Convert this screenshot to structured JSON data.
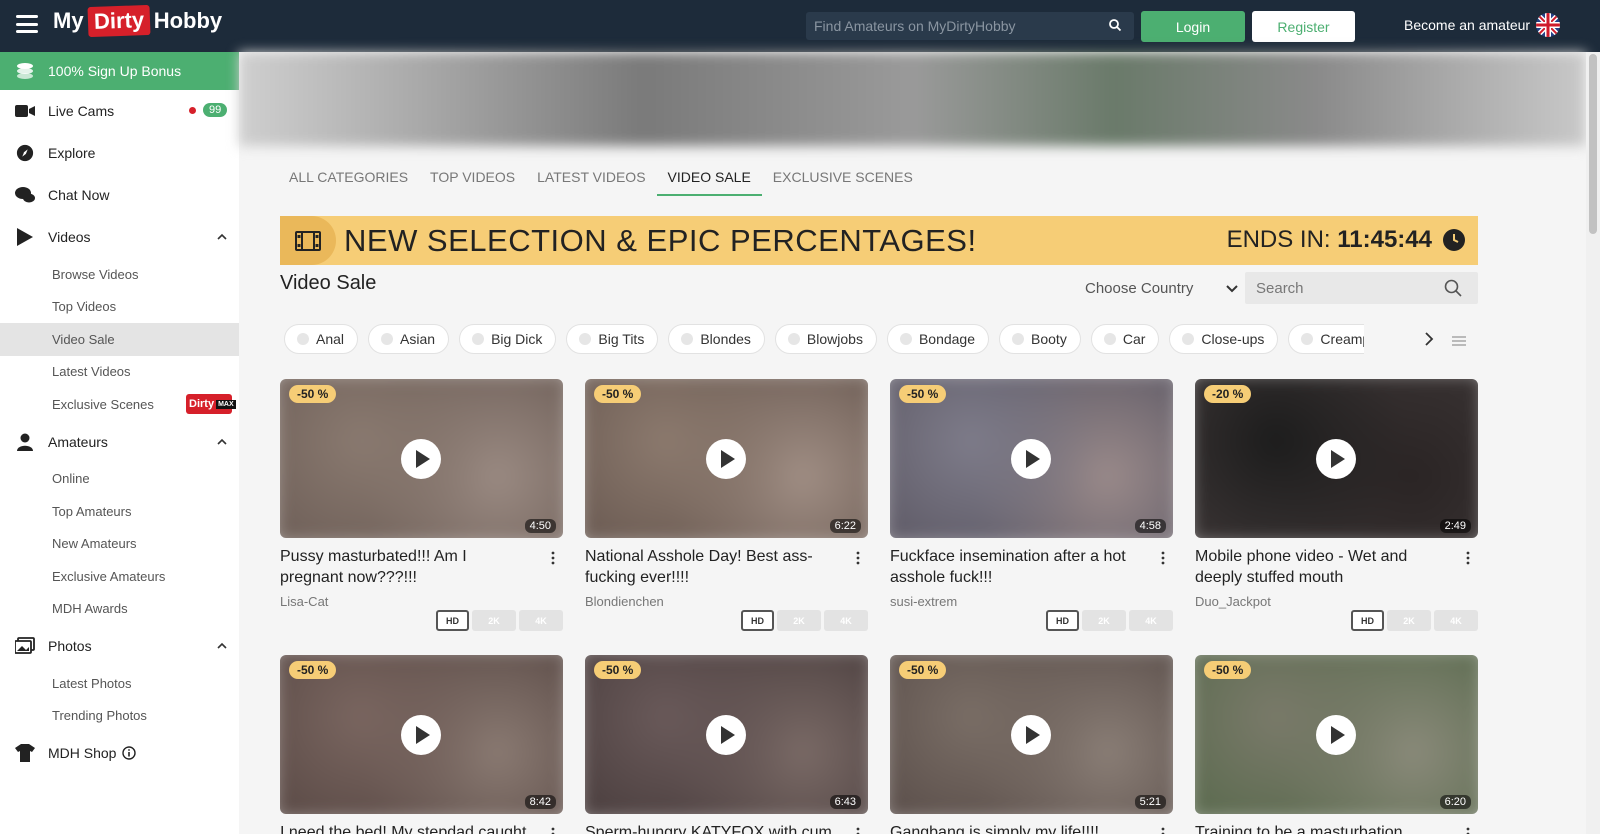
{
  "header": {
    "logo": {
      "my": "My",
      "dirty": "Dirty",
      "hobby": "Hobby"
    },
    "search_placeholder": "Find Amateurs on MyDirtyHobby",
    "login_label": "Login",
    "register_label": "Register",
    "become_label": "Become an amateur",
    "flag_icon": "uk-flag-icon"
  },
  "sidebar": {
    "bonus": "100% Sign Up Bonus",
    "live_cams": {
      "label": "Live Cams",
      "count": "99"
    },
    "explore": "Explore",
    "chat_now": "Chat Now",
    "videos": {
      "label": "Videos",
      "items": [
        "Browse Videos",
        "Top Videos",
        "Video Sale",
        "Latest Videos",
        "Exclusive Scenes"
      ],
      "exclusive_badge": {
        "dirty": "Dirty",
        "max": "MAX"
      }
    },
    "amateurs": {
      "label": "Amateurs",
      "items": [
        "Online",
        "Top Amateurs",
        "New Amateurs",
        "Exclusive Amateurs",
        "MDH Awards"
      ]
    },
    "photos": {
      "label": "Photos",
      "items": [
        "Latest Photos",
        "Trending Photos"
      ]
    },
    "shop": "MDH Shop"
  },
  "tabs": [
    "ALL CATEGORIES",
    "TOP VIDEOS",
    "LATEST VIDEOS",
    "VIDEO SALE",
    "EXCLUSIVE SCENES"
  ],
  "active_tab": 3,
  "sale": {
    "headline": "NEW SELECTION & EPIC PERCENTAGES!",
    "ends_label": "ENDS IN:",
    "ends_time": "11:45:44"
  },
  "section_title": "Video Sale",
  "country_label": "Choose Country",
  "search_placeholder": "Search",
  "categories": [
    "Anal",
    "Asian",
    "Big Dick",
    "Big Tits",
    "Blondes",
    "Blowjobs",
    "Bondage",
    "Booty",
    "Car",
    "Close-ups",
    "Creampie"
  ],
  "videos": [
    {
      "discount": "-50 %",
      "duration": "4:50",
      "title": "Pussy masturbated!!! Am I pregnant now???!!!",
      "author": "Lisa-Cat",
      "tones": [
        "#8a7a70",
        "#6e5f58",
        "#9a8a82"
      ]
    },
    {
      "discount": "-50 %",
      "duration": "6:22",
      "title": "National Asshole Day! Best ass-fucking ever!!!!",
      "author": "Blondienchen",
      "tones": [
        "#8c7a6e",
        "#6a5a52",
        "#a08e84"
      ]
    },
    {
      "discount": "-50 %",
      "duration": "4:58",
      "title": "Fuckface insemination after a hot asshole fuck!!!",
      "author": "susi-extrem",
      "tones": [
        "#7e7c8a",
        "#5e5a66",
        "#9a8a8a"
      ]
    },
    {
      "discount": "-20 %",
      "duration": "2:49",
      "title": "Mobile phone video - Wet and deeply stuffed mouth",
      "author": "Duo_Jackpot",
      "tones": [
        "#1c1c1c",
        "#3a3434",
        "#2a2424"
      ]
    },
    {
      "discount": "-50 %",
      "duration": "8:42",
      "title": "I need the bed! My stepdad caught",
      "author": "",
      "tones": [
        "#7a6660",
        "#5a4a46",
        "#8a7a72"
      ]
    },
    {
      "discount": "-50 %",
      "duration": "6:43",
      "title": "Sperm-hungry KATYFOX with cum",
      "author": "",
      "tones": [
        "#6a5a5a",
        "#4a3e3e",
        "#7a6a66"
      ]
    },
    {
      "discount": "-50 %",
      "duration": "5:21",
      "title": "Gangbang is simply my life!!!!",
      "author": "",
      "tones": [
        "#7a6e66",
        "#5a4e4a",
        "#8a7e76"
      ]
    },
    {
      "discount": "-50 %",
      "duration": "6:20",
      "title": "Training to be a masturbation",
      "author": "",
      "tones": [
        "#7a7a6a",
        "#5a6a4e",
        "#8a8a7a"
      ]
    }
  ],
  "quality_badges": [
    "HD",
    "2K",
    "4K"
  ]
}
